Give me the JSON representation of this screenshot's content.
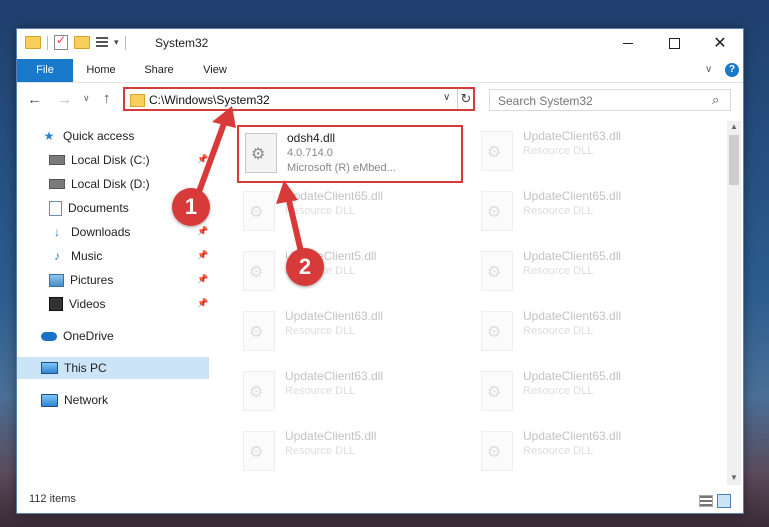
{
  "window": {
    "title": "System32",
    "controls": {
      "minimize": "–",
      "maximize": "☐",
      "close": "✕"
    }
  },
  "ribbon": {
    "tabs": [
      "File",
      "Home",
      "Share",
      "View"
    ],
    "help": "?"
  },
  "navbar": {
    "back": "←",
    "forward": "→",
    "recent": "∨",
    "up": "↑",
    "address": "C:\\Windows\\System32",
    "address_dropdown": "∨",
    "refresh": "↻",
    "search_placeholder": "Search System32",
    "search_icon": "⌕"
  },
  "sidebar": {
    "items": [
      {
        "label": "Quick access",
        "icon": "star-icon"
      },
      {
        "label": "Local Disk (C:)",
        "icon": "disk-icon",
        "pinned": true
      },
      {
        "label": "Local Disk (D:)",
        "icon": "disk-icon"
      },
      {
        "label": "Documents",
        "icon": "documents-icon",
        "pinned": true
      },
      {
        "label": "Downloads",
        "icon": "download-icon",
        "pinned": true
      },
      {
        "label": "Music",
        "icon": "music-icon",
        "pinned": true
      },
      {
        "label": "Pictures",
        "icon": "pictures-icon",
        "pinned": true
      },
      {
        "label": "Videos",
        "icon": "videos-icon",
        "pinned": true
      },
      {
        "label": "OneDrive",
        "icon": "cloud-icon"
      },
      {
        "label": "This PC",
        "icon": "computer-icon",
        "selected": true
      },
      {
        "label": "Network",
        "icon": "network-icon"
      }
    ]
  },
  "files": {
    "highlighted": {
      "name": "odsh4.dll",
      "version": "4.0.714.0",
      "company": "Microsoft (R) eMbed..."
    },
    "left_column": [
      {
        "name": "UpdateClient65.dll",
        "type": "Resource DLL"
      },
      {
        "name": "UpdateClient5.dll",
        "type": "Resource DLL"
      },
      {
        "name": "UpdateClient63.dll",
        "type": "Resource DLL"
      },
      {
        "name": "UpdateClient63.dll",
        "type": "Resource DLL"
      },
      {
        "name": "UpdateClient5.dll",
        "type": "Resource DLL"
      }
    ],
    "right_column": [
      {
        "name": "UpdateClient63.dll",
        "type": "Resource DLL"
      },
      {
        "name": "UpdateClient65.dll",
        "type": "Resource DLL"
      },
      {
        "name": "UpdateClient65.dll",
        "type": "Resource DLL"
      },
      {
        "name": "UpdateClient63.dll",
        "type": "Resource DLL"
      },
      {
        "name": "UpdateClient65.dll",
        "type": "Resource DLL"
      },
      {
        "name": "UpdateClient63.dll",
        "type": "Resource DLL"
      }
    ]
  },
  "statusbar": {
    "count": "112 items"
  },
  "annotations": {
    "one": "1",
    "two": "2",
    "color": "#d83a3a"
  }
}
